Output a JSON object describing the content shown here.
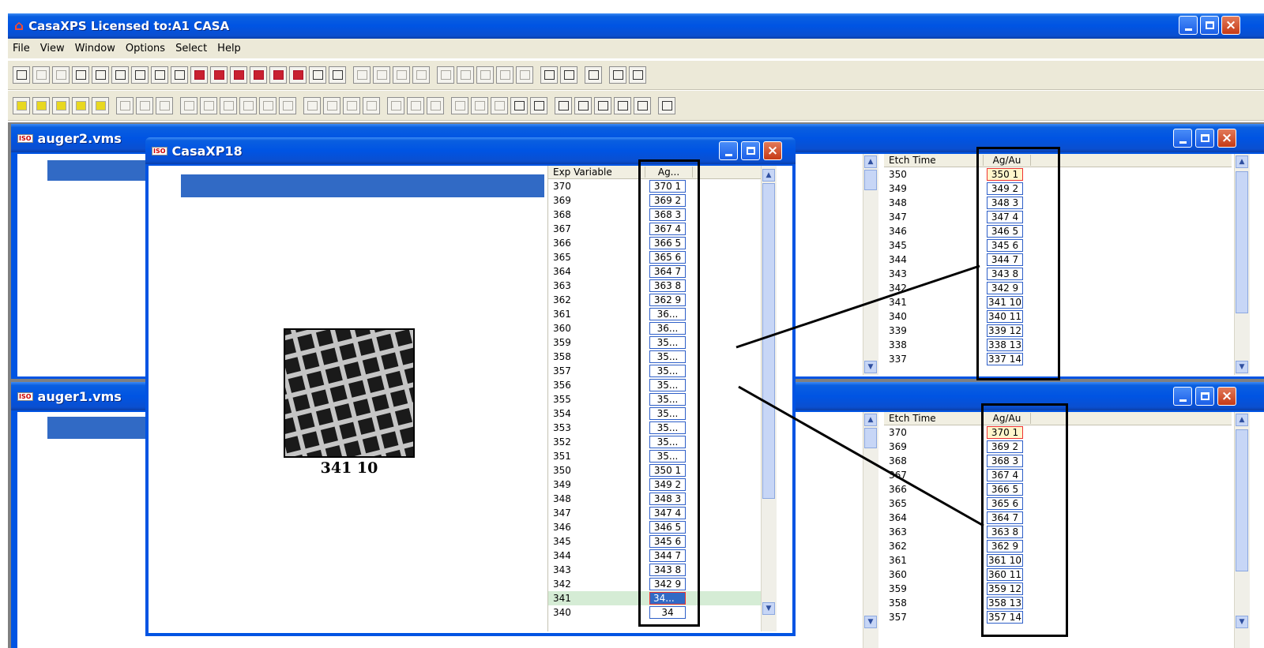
{
  "app": {
    "title": "CasaXPS Licensed to:A1 CASA",
    "menu": [
      "File",
      "View",
      "Window",
      "Options",
      "Select",
      "Help"
    ]
  },
  "windows": {
    "auger2": {
      "title": "auger2.vms"
    },
    "auger1": {
      "title": "auger1.vms"
    },
    "casaxp": {
      "title": "CasaXP18"
    }
  },
  "casaxp_list": {
    "col1": "Exp Variable",
    "col2": "Ag...",
    "rows": [
      {
        "label": "370",
        "val": "370 1"
      },
      {
        "label": "369",
        "val": "369 2"
      },
      {
        "label": "368",
        "val": "368 3"
      },
      {
        "label": "367",
        "val": "367 4"
      },
      {
        "label": "366",
        "val": "366 5"
      },
      {
        "label": "365",
        "val": "365 6"
      },
      {
        "label": "364",
        "val": "364 7"
      },
      {
        "label": "363",
        "val": "363 8"
      },
      {
        "label": "362",
        "val": "362 9"
      },
      {
        "label": "361",
        "val": "36..."
      },
      {
        "label": "360",
        "val": "36..."
      },
      {
        "label": "359",
        "val": "35..."
      },
      {
        "label": "358",
        "val": "35..."
      },
      {
        "label": "357",
        "val": "35..."
      },
      {
        "label": "356",
        "val": "35..."
      },
      {
        "label": "355",
        "val": "35..."
      },
      {
        "label": "354",
        "val": "35..."
      },
      {
        "label": "353",
        "val": "35..."
      },
      {
        "label": "352",
        "val": "35..."
      },
      {
        "label": "351",
        "val": "35..."
      },
      {
        "label": "350",
        "val": "350 1"
      },
      {
        "label": "349",
        "val": "349 2"
      },
      {
        "label": "348",
        "val": "348 3"
      },
      {
        "label": "347",
        "val": "347 4"
      },
      {
        "label": "346",
        "val": "346 5"
      },
      {
        "label": "345",
        "val": "345 6"
      },
      {
        "label": "344",
        "val": "344 7"
      },
      {
        "label": "343",
        "val": "343 8"
      },
      {
        "label": "342",
        "val": "342 9"
      },
      {
        "label": "341",
        "val": "34..."
      },
      {
        "label": "340",
        "val": "34"
      }
    ]
  },
  "image_caption": "341 10",
  "auger2_list": {
    "col1": "Etch Time",
    "col2": "Ag/Au",
    "rows": [
      {
        "label": "350",
        "val": "350 1"
      },
      {
        "label": "349",
        "val": "349 2"
      },
      {
        "label": "348",
        "val": "348 3"
      },
      {
        "label": "347",
        "val": "347 4"
      },
      {
        "label": "346",
        "val": "346 5"
      },
      {
        "label": "345",
        "val": "345 6"
      },
      {
        "label": "344",
        "val": "344 7"
      },
      {
        "label": "343",
        "val": "343 8"
      },
      {
        "label": "342",
        "val": "342 9"
      },
      {
        "label": "341",
        "val": "341 10"
      },
      {
        "label": "340",
        "val": "340 11"
      },
      {
        "label": "339",
        "val": "339 12"
      },
      {
        "label": "338",
        "val": "338 13"
      },
      {
        "label": "337",
        "val": "337 14"
      }
    ]
  },
  "auger1_list": {
    "col1": "Etch Time",
    "col2": "Ag/Au",
    "rows": [
      {
        "label": "370",
        "val": "370 1"
      },
      {
        "label": "369",
        "val": "369 2"
      },
      {
        "label": "368",
        "val": "368 3"
      },
      {
        "label": "367",
        "val": "367 4"
      },
      {
        "label": "366",
        "val": "366 5"
      },
      {
        "label": "365",
        "val": "365 6"
      },
      {
        "label": "364",
        "val": "364 7"
      },
      {
        "label": "363",
        "val": "363 8"
      },
      {
        "label": "362",
        "val": "362 9"
      },
      {
        "label": "361",
        "val": "361 10"
      },
      {
        "label": "360",
        "val": "360 11"
      },
      {
        "label": "359",
        "val": "359 12"
      },
      {
        "label": "358",
        "val": "358 13"
      },
      {
        "label": "357",
        "val": "357 14"
      }
    ]
  },
  "toolbar1": [
    "new",
    "open",
    "open-folder",
    "save",
    "copy",
    "copy2",
    "copy3",
    "copy4",
    "page",
    "red1",
    "red2",
    "red3",
    "red4",
    "red5",
    "red6",
    "iso",
    "clip",
    "win1",
    "win2",
    "win3",
    "arrow",
    "pen",
    "grid",
    "peak1",
    "peak2",
    "peak3",
    "clip2",
    "dynamite",
    "print",
    "preview",
    "help"
  ],
  "toolbar2": [
    "tile1",
    "tile2",
    "tile3",
    "tile4",
    "tile5",
    "nav1",
    "nav2",
    "nav3",
    "pk1",
    "pk2",
    "pk3",
    "pk4",
    "pk5",
    "pk6",
    "be",
    "cps",
    "mark",
    "area",
    "b1",
    "b2",
    "b3",
    "BG",
    "BG-SUB",
    "mn",
    "Block Com",
    "Block Info",
    "Exp Var",
    "Exp Var",
    "EL TR",
    "hv",
    "ware",
    "EDIT MODE"
  ]
}
